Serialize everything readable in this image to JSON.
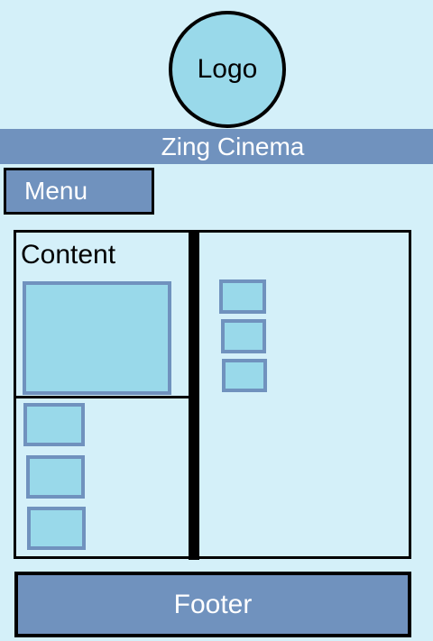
{
  "logo": {
    "label": "Logo"
  },
  "header": {
    "title": "Zing Cinema"
  },
  "menu": {
    "label": "Menu"
  },
  "content": {
    "label": "Content"
  },
  "footer": {
    "label": "Footer"
  },
  "colors": {
    "background": "#d4f0f9",
    "bar": "#7092be",
    "placeholder_fill": "#99d9ea",
    "placeholder_border": "#7092be",
    "outline": "#000000",
    "bar_text": "#ffffff"
  }
}
